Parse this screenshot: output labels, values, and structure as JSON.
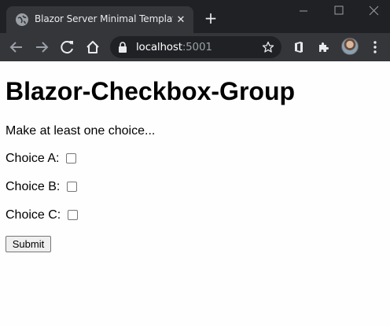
{
  "browser": {
    "tab_title": "Blazor Server Minimal Template",
    "url_host": "localhost",
    "url_port": ":5001"
  },
  "page": {
    "title": "Blazor-Checkbox-Group",
    "instruction": "Make at least one choice...",
    "choices": [
      {
        "label": "Choice A:",
        "checked": false
      },
      {
        "label": "Choice B:",
        "checked": false
      },
      {
        "label": "Choice C:",
        "checked": false
      }
    ],
    "submit_label": "Submit"
  },
  "colors": {
    "titlebar": "#202124",
    "toolbar": "#35363a",
    "page_bg": "#fefefe"
  },
  "icons": [
    "globe-icon",
    "close-icon",
    "plus-icon",
    "minimize-icon",
    "maximize-icon",
    "window-close-icon",
    "back-arrow-icon",
    "forward-arrow-icon",
    "reload-icon",
    "home-icon",
    "lock-icon",
    "star-icon",
    "office-extension-icon",
    "puzzle-extension-icon",
    "menu-dots-icon"
  ]
}
